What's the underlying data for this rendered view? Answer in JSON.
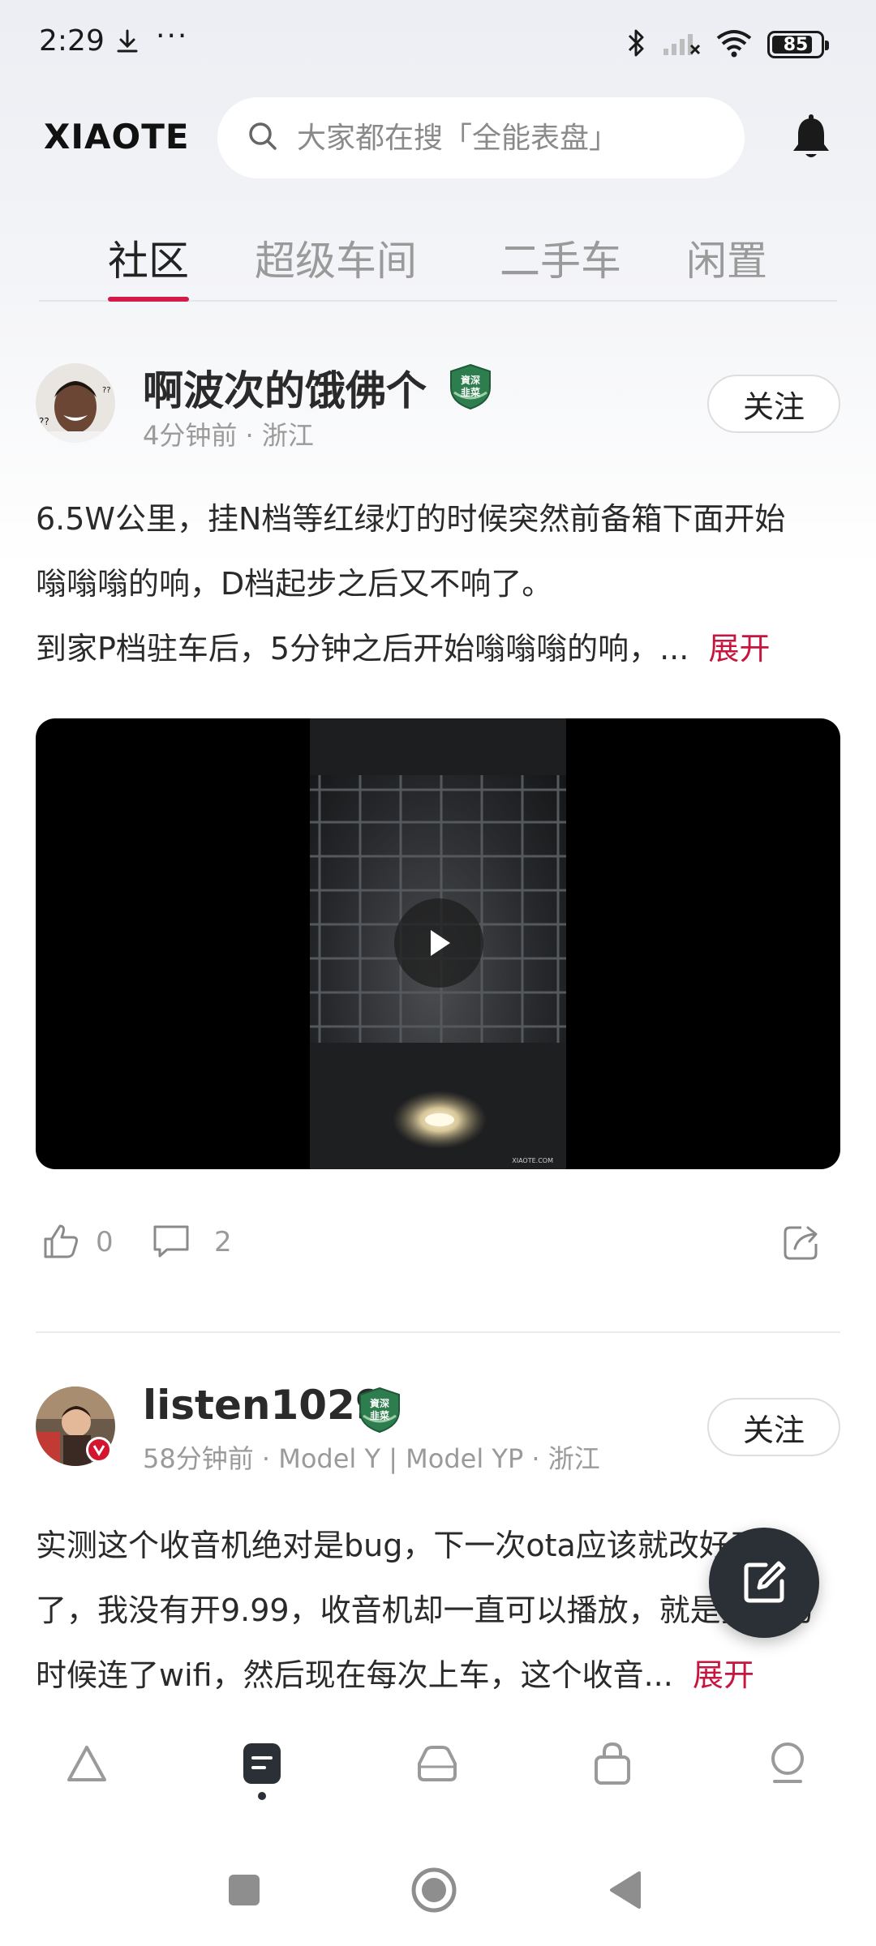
{
  "status_bar": {
    "time": "2:29",
    "more": "···",
    "battery": "85",
    "battery_level": 0.85
  },
  "header": {
    "logo": "XIAOTE",
    "search_placeholder": "大家都在搜「全能表盘」"
  },
  "tabs": [
    {
      "label": "社区",
      "active": true
    },
    {
      "label": "超级车间",
      "active": false
    },
    {
      "label": "二手车",
      "active": false
    },
    {
      "label": "闲置",
      "active": false
    }
  ],
  "posts": [
    {
      "username": "啊波次的饿佛个",
      "badge_text": "資深韭菜",
      "meta": "4分钟前 · 浙江",
      "follow_label": "关注",
      "body_line1": "6.5W公里，挂N档等红绿灯的时候突然前备箱下面开始",
      "body_line2": "嗡嗡嗡的响，D档起步之后又不响了。",
      "body_line3": "到家P档驻车后，5分钟之后开始嗡嗡嗡的响，...",
      "expand_label": "展开",
      "video_watermark": "XIAOTE.COM",
      "likes": "0",
      "comments": "2"
    },
    {
      "username": "listen1029",
      "badge_text": "資深韭菜",
      "meta": "58分钟前 · Model Y | Model YP · 浙江",
      "follow_label": "关注",
      "body_line1": "实测这个收音机绝对是bug，下一次ota应该就改好了",
      "body_line2": "了，我没有开9.99，收音机却一直可以播放，就是提车的",
      "body_line3": "时候连了wifi，然后现在每次上车，这个收音...",
      "expand_label": "展开"
    }
  ],
  "colors": {
    "accent": "#c8153d",
    "tab_underline": "#d21b48",
    "fab": "#2b2f36",
    "badge_green": "#2e7d4f"
  },
  "bottom_nav": [
    {
      "icon": "home-triangle-icon",
      "active": false
    },
    {
      "icon": "community-doc-icon",
      "active": true
    },
    {
      "icon": "car-icon",
      "active": false
    },
    {
      "icon": "shop-bag-icon",
      "active": false
    },
    {
      "icon": "profile-icon",
      "active": false
    }
  ],
  "system_nav": [
    "recents-square-icon",
    "home-circle-icon",
    "back-triangle-icon"
  ]
}
